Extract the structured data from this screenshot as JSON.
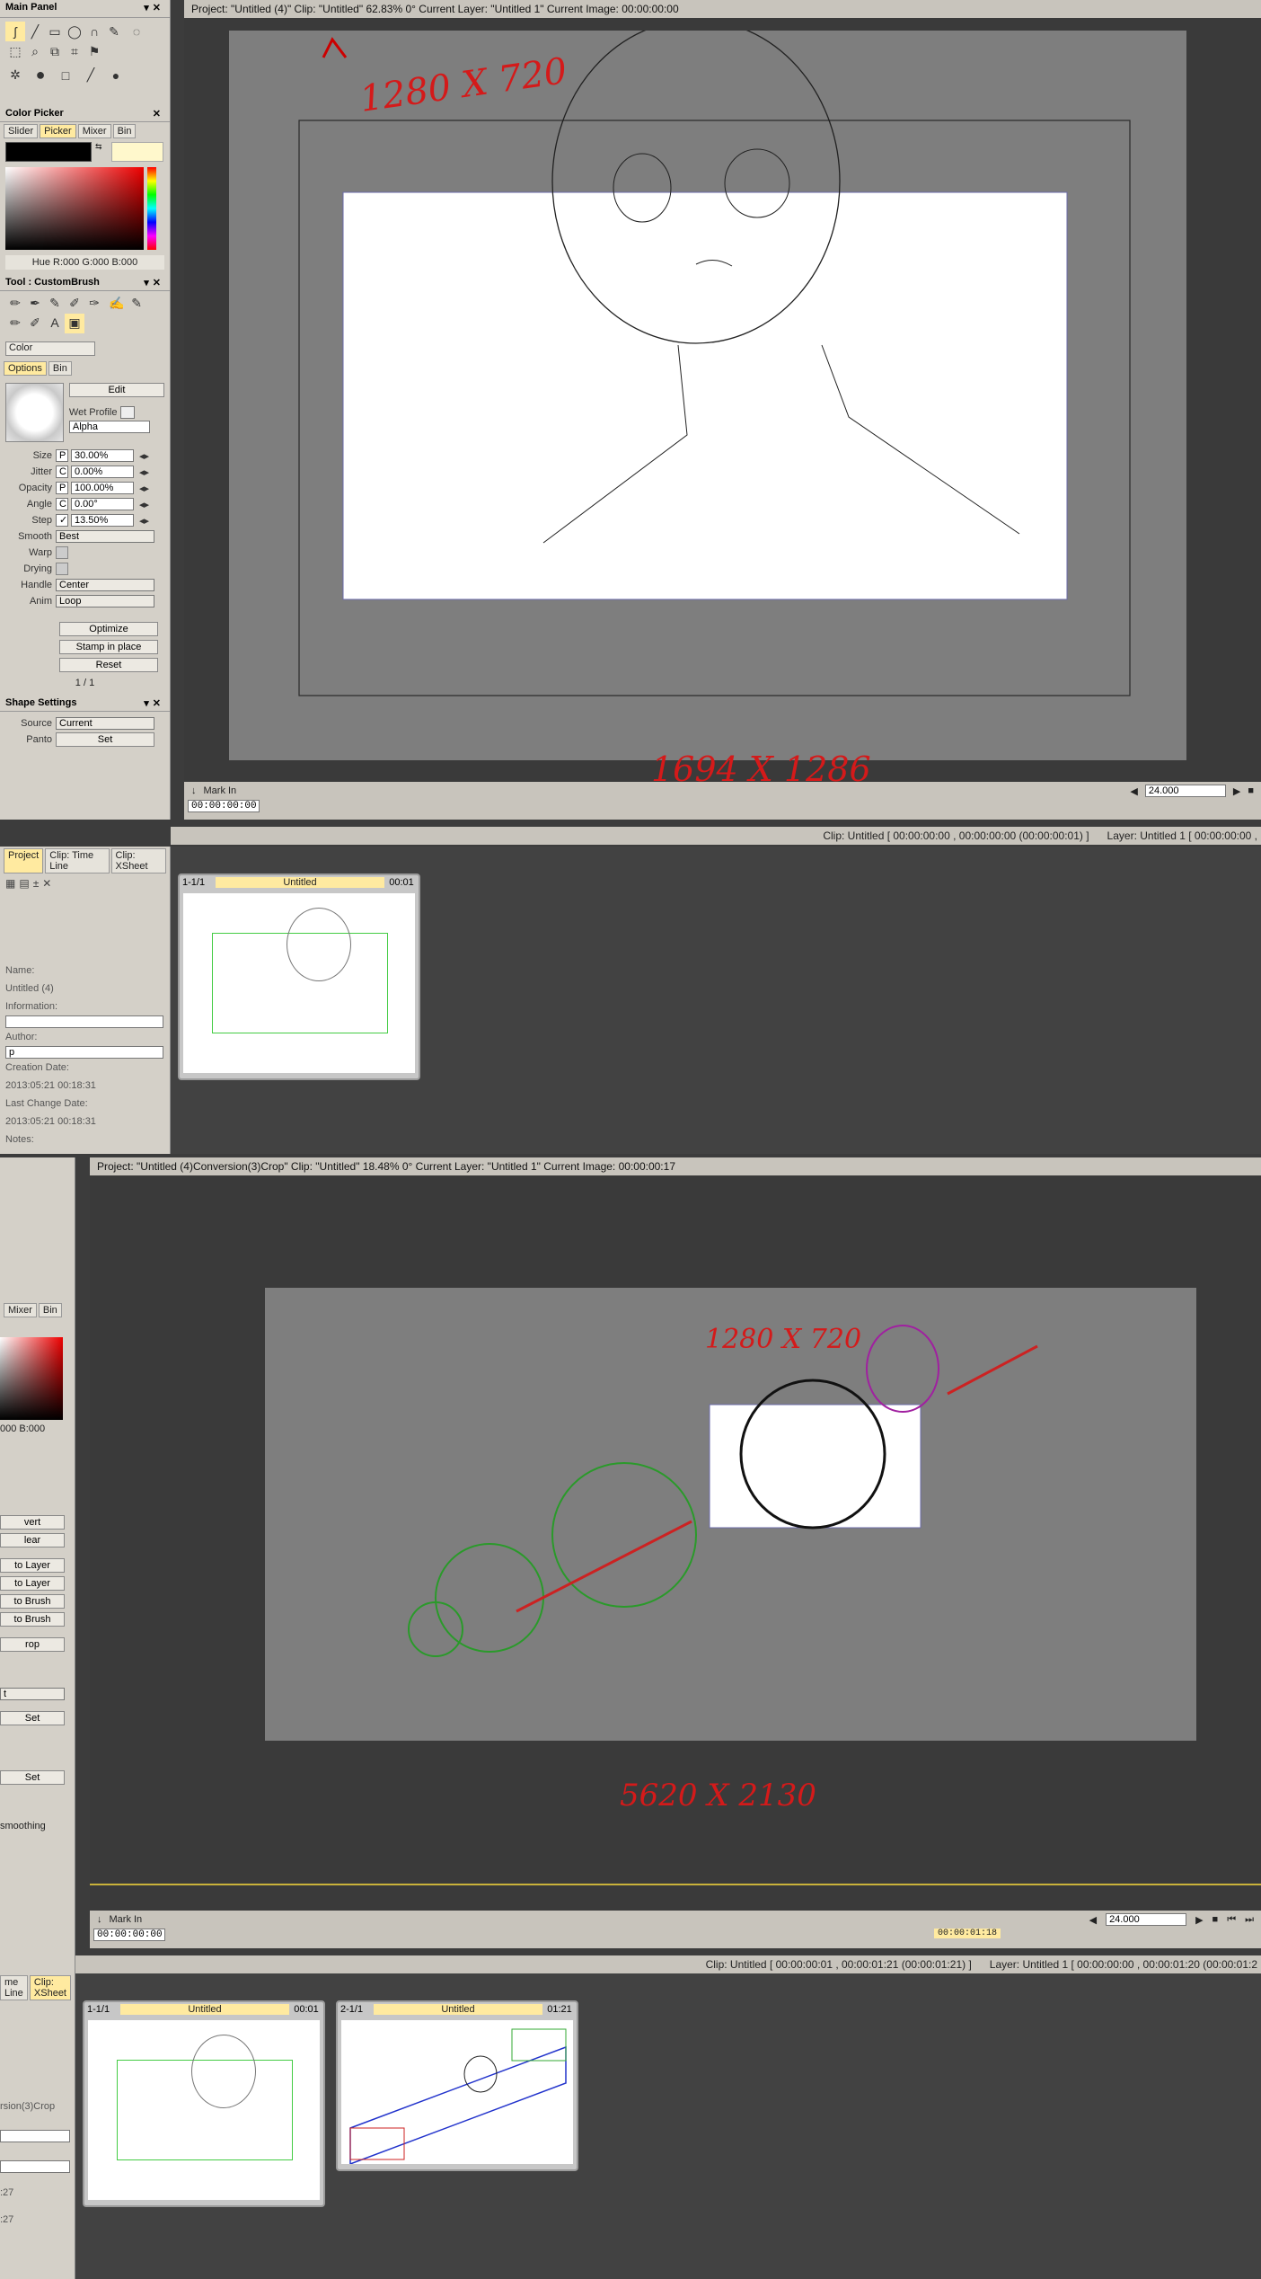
{
  "main_panel": {
    "title": "Main Panel"
  },
  "color_picker": {
    "title": "Color Picker",
    "tabs": [
      "Slider",
      "Picker",
      "Mixer",
      "Bin"
    ],
    "hsb": "Hue R:000 G:000 B:000"
  },
  "tool": {
    "title": "Tool : CustomBrush",
    "mode": "Color",
    "tabs": [
      "Options",
      "Bin"
    ],
    "edit": "Edit",
    "wet_profile": "Wet Profile",
    "alpha": "Alpha",
    "params": [
      {
        "label": "Size",
        "flag": "P",
        "value": "30.00%"
      },
      {
        "label": "Jitter",
        "flag": "C",
        "value": "0.00%"
      },
      {
        "label": "Opacity",
        "flag": "P",
        "value": "100.00%"
      },
      {
        "label": "Angle",
        "flag": "C",
        "value": "0.00°"
      },
      {
        "label": "Step",
        "flag": "✓",
        "value": "13.50%"
      }
    ],
    "smooth_label": "Smooth",
    "smooth": "Best",
    "warp": "Warp",
    "drying": "Drying",
    "handle_label": "Handle",
    "handle": "Center",
    "anim_label": "Anim",
    "anim": "Loop",
    "optimize": "Optimize",
    "stamp": "Stamp in place",
    "reset": "Reset",
    "page": "1 / 1"
  },
  "shape_settings": {
    "title": "Shape Settings",
    "source_label": "Source",
    "source": "Current",
    "panto_label": "Panto",
    "set": "Set"
  },
  "viewer1": {
    "status": "Project: \"Untitled (4)\"  Clip: \"Untitled\"   62.83%   0°  Current Layer: \"Untitled 1\"  Current Image: 00:00:00:00",
    "mark_in": "Mark In",
    "timecode": "00:00:00:00",
    "fps": "24.000",
    "note_top": "1280 X 720",
    "note_bottom": "1694 X 1286"
  },
  "clip_bar1": {
    "clip": "Clip: Untitled [ 00:00:00:00 , 00:00:00:00  (00:00:00:01) ]",
    "layer": "Layer: Untitled 1 [ 00:00:00:00 ,"
  },
  "project1": {
    "tabs": [
      "Project",
      "Clip: Time Line",
      "Clip: XSheet"
    ],
    "name_label": "Name:",
    "name": "Untitled (4)",
    "info_label": "Information:",
    "author_label": "Author:",
    "author": "p",
    "created_label": "Creation Date:",
    "created": "2013:05:21 00:18:31",
    "changed_label": "Last Change Date:",
    "changed": "2013:05:21 00:18:31",
    "notes_label": "Notes:",
    "card": {
      "num": "1-1/1",
      "title": "Untitled",
      "dur": "00:01"
    }
  },
  "viewer2": {
    "status": "Project: \"Untitled (4)Conversion(3)Crop\"  Clip: \"Untitled\"   18.48%   0°  Current Layer: \"Untitled 1\"  Current Image: 00:00:00:17",
    "mark_in": "Mark In",
    "timecode": "00:00:00:00",
    "fps": "24.000",
    "note_top": "1280 X 720",
    "note_bottom": "5620 X 2130",
    "playhead": "00:00:01:18"
  },
  "left2": {
    "tabs": [
      "Mixer",
      "Bin"
    ],
    "hsb": "000 B:000",
    "buttons": [
      "vert",
      "lear",
      "to Layer",
      "to Layer",
      "to Brush",
      "to Brush",
      "rop"
    ],
    "set1": "Set",
    "set2": "Set",
    "smoothing": "smoothing",
    "mode": "t"
  },
  "clip_bar2": {
    "clip": "Clip: Untitled [ 00:00:00:01 , 00:00:01:21  (00:00:01:21) ]",
    "layer": "Layer: Untitled 1 [ 00:00:00:00 , 00:00:01:20  (00:00:01:2"
  },
  "project2": {
    "tabs": [
      "me Line",
      "Clip: XSheet"
    ],
    "name": "rsion(3)Crop",
    "d1": ":27",
    "d2": ":27",
    "cards": [
      {
        "num": "1-1/1",
        "title": "Untitled",
        "dur": "00:01"
      },
      {
        "num": "2-1/1",
        "title": "Untitled",
        "dur": "01:21"
      }
    ]
  }
}
